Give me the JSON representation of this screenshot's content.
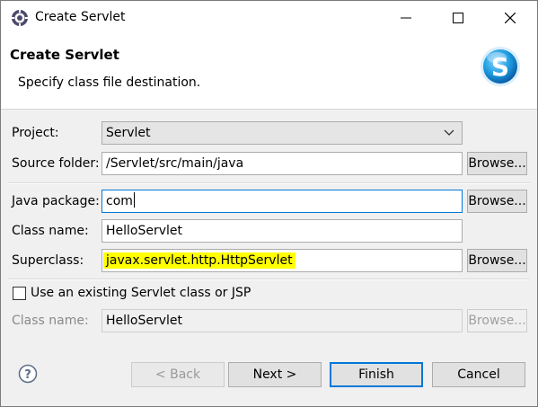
{
  "window": {
    "title": "Create Servlet",
    "icon": "eclipse-gear-icon"
  },
  "banner": {
    "title": "Create Servlet",
    "description": "Specify class file destination.",
    "logo": "servlet-s-logo-icon"
  },
  "form": {
    "project": {
      "label": "Project:",
      "value": "Servlet"
    },
    "source_folder": {
      "label": "Source folder:",
      "value": "/Servlet/src/main/java",
      "browse": "Browse..."
    },
    "java_package": {
      "label": "Java package:",
      "value": "com",
      "browse": "Browse..."
    },
    "class_name": {
      "label": "Class name:",
      "value": "HelloServlet"
    },
    "superclass": {
      "label": "Superclass:",
      "value": "javax.servlet.http.HttpServlet",
      "browse": "Browse..."
    },
    "existing": {
      "label": "Use an existing Servlet class or JSP",
      "checked": false
    },
    "existing_class_name": {
      "label": "Class name:",
      "value": "HelloServlet",
      "browse": "Browse..."
    }
  },
  "footer": {
    "help_icon": "question-circle-icon",
    "back": "< Back",
    "next": "Next >",
    "finish": "Finish",
    "cancel": "Cancel"
  },
  "colors": {
    "accent": "#0078d7",
    "highlight": "#ffff00"
  }
}
